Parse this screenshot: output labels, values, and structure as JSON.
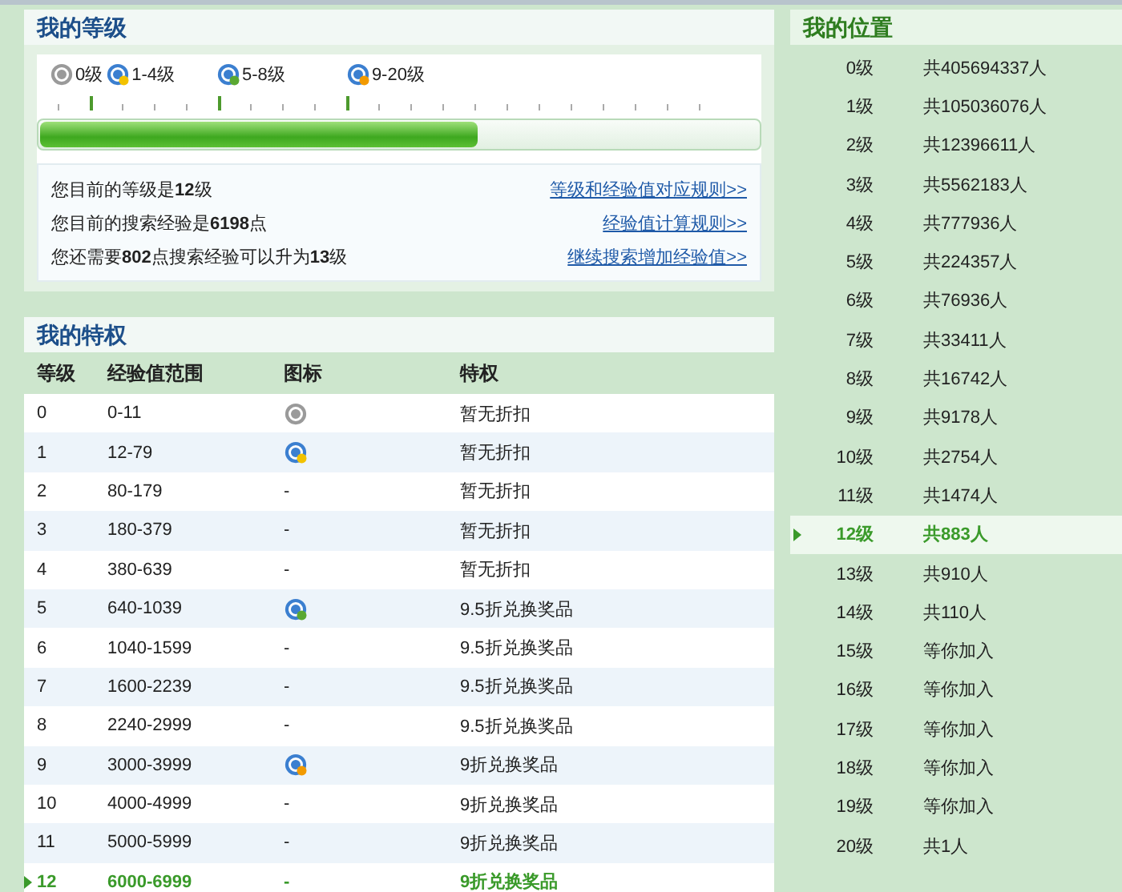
{
  "my_level": {
    "title": "我的等级",
    "scale_labels": [
      {
        "text": "0级",
        "kind": "gray"
      },
      {
        "text": "1-4级",
        "kind": "star"
      },
      {
        "text": "5-8级",
        "kind": "leaf"
      },
      {
        "text": "9-20级",
        "kind": "sun"
      }
    ],
    "progress": {
      "level": 0.61
    },
    "info": [
      {
        "text": "您目前的等级是**12**级",
        "link": "等级和经验值对应规则>>"
      },
      {
        "text": "您目前的搜索经验是**6198**点",
        "link": "经验值计算规则>>"
      },
      {
        "text": "您还需要**802**点搜索经验可以升为**13**级",
        "link": "继续搜索增加经验值>>"
      }
    ]
  },
  "privileges": {
    "title": "我的特权",
    "columns": [
      "等级",
      "经验值范围",
      "图标",
      "特权"
    ],
    "rows": [
      {
        "level": "0",
        "range": "0-11",
        "kind": "gray",
        "privilege": "暂无折扣",
        "selected": false
      },
      {
        "level": "1",
        "range": "12-79",
        "kind": "star",
        "privilege": "暂无折扣",
        "selected": false
      },
      {
        "level": "2",
        "range": "80-179",
        "icon": "-",
        "privilege": "暂无折扣",
        "selected": false
      },
      {
        "level": "3",
        "range": "180-379",
        "icon": "-",
        "privilege": "暂无折扣",
        "selected": false
      },
      {
        "level": "4",
        "range": "380-639",
        "icon": "-",
        "privilege": "暂无折扣",
        "selected": false
      },
      {
        "level": "5",
        "range": "640-1039",
        "kind": "leaf",
        "privilege": "9.5折兑换奖品",
        "selected": false
      },
      {
        "level": "6",
        "range": "1040-1599",
        "icon": "-",
        "privilege": "9.5折兑换奖品",
        "selected": false
      },
      {
        "level": "7",
        "range": "1600-2239",
        "icon": "-",
        "privilege": "9.5折兑换奖品",
        "selected": false
      },
      {
        "level": "8",
        "range": "2240-2999",
        "icon": "-",
        "privilege": "9.5折兑换奖品",
        "selected": false
      },
      {
        "level": "9",
        "range": "3000-3999",
        "kind": "sun",
        "privilege": "9折兑换奖品",
        "selected": false
      },
      {
        "level": "10",
        "range": "4000-4999",
        "icon": "-",
        "privilege": "9折兑换奖品",
        "selected": false
      },
      {
        "level": "11",
        "range": "5000-5999",
        "icon": "-",
        "privilege": "9折兑换奖品",
        "selected": false
      },
      {
        "level": "12",
        "range": "6000-6999",
        "icon": "-",
        "privilege": "9折兑换奖品",
        "selected": true
      }
    ]
  },
  "my_position": {
    "title": "我的位置",
    "rows": [
      {
        "level": "0级",
        "count": "共405694337人",
        "selected": false
      },
      {
        "level": "1级",
        "count": "共105036076人",
        "selected": false
      },
      {
        "level": "2级",
        "count": "共12396611人",
        "selected": false
      },
      {
        "level": "3级",
        "count": "共5562183人",
        "selected": false
      },
      {
        "level": "4级",
        "count": "共777936人",
        "selected": false
      },
      {
        "level": "5级",
        "count": "共224357人",
        "selected": false
      },
      {
        "level": "6级",
        "count": "共76936人",
        "selected": false
      },
      {
        "level": "7级",
        "count": "共33411人",
        "selected": false
      },
      {
        "level": "8级",
        "count": "共16742人",
        "selected": false
      },
      {
        "level": "9级",
        "count": "共9178人",
        "selected": false
      },
      {
        "level": "10级",
        "count": "共2754人",
        "selected": false
      },
      {
        "level": "11级",
        "count": "共1474人",
        "selected": false
      },
      {
        "level": "12级",
        "count": "共883人",
        "selected": true
      },
      {
        "level": "13级",
        "count": "共910人",
        "selected": false
      },
      {
        "level": "14级",
        "count": "共110人",
        "selected": false
      },
      {
        "level": "15级",
        "count": "等你加入",
        "selected": false
      },
      {
        "level": "16级",
        "count": "等你加入",
        "selected": false
      },
      {
        "level": "17级",
        "count": "等你加入",
        "selected": false
      },
      {
        "level": "18级",
        "count": "等你加入",
        "selected": false
      },
      {
        "level": "19级",
        "count": "等你加入",
        "selected": false
      },
      {
        "level": "20级",
        "count": "共1人",
        "selected": false
      }
    ]
  }
}
